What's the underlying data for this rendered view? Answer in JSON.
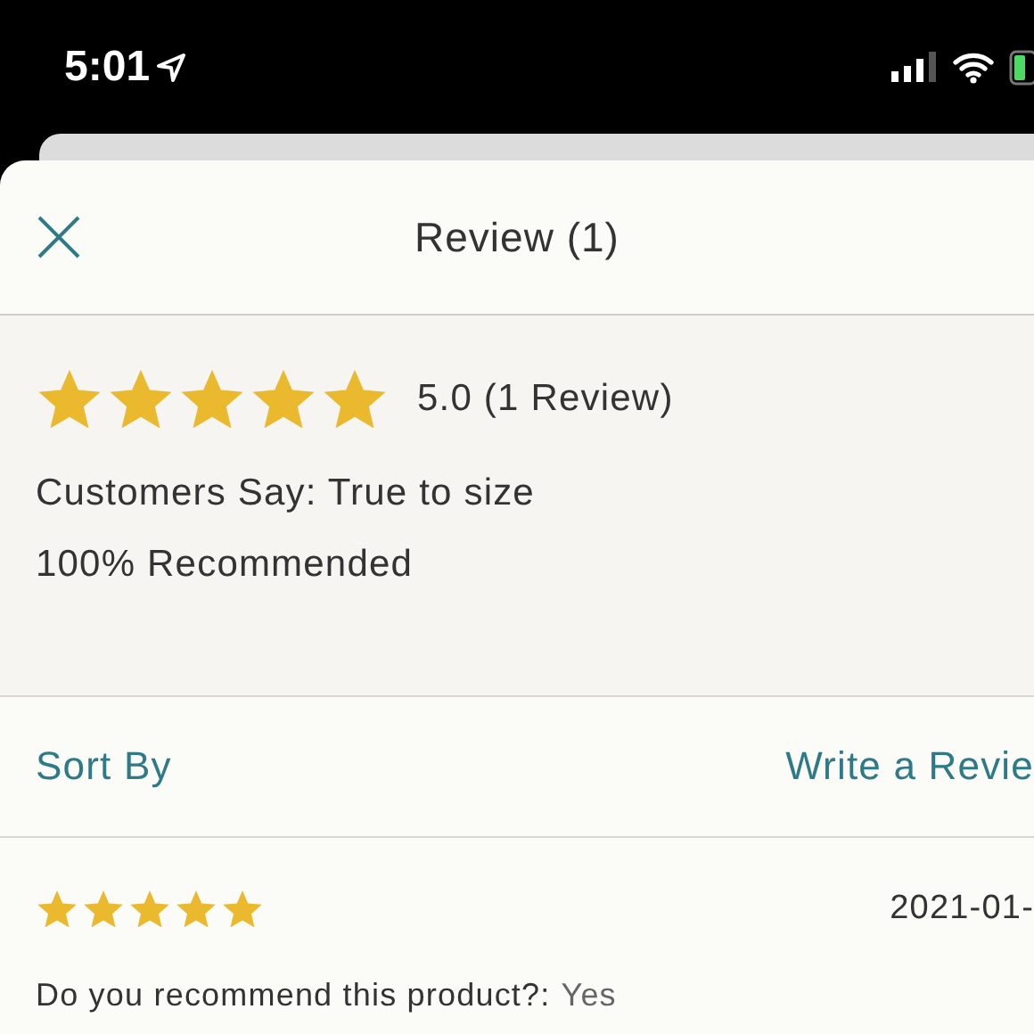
{
  "status_bar": {
    "time": "5:01"
  },
  "header": {
    "title": "Review (1)"
  },
  "summary": {
    "stars": 5,
    "rating": "5.0 (1 Review)",
    "customers_say": "Customers Say: True to size",
    "recommended": "100% Recommended"
  },
  "actions": {
    "sort": "Sort By",
    "write": "Write a Revie"
  },
  "review": {
    "stars": 5,
    "date": "2021-01-",
    "question": "Do you recommend this product?:",
    "answer": "Yes"
  }
}
